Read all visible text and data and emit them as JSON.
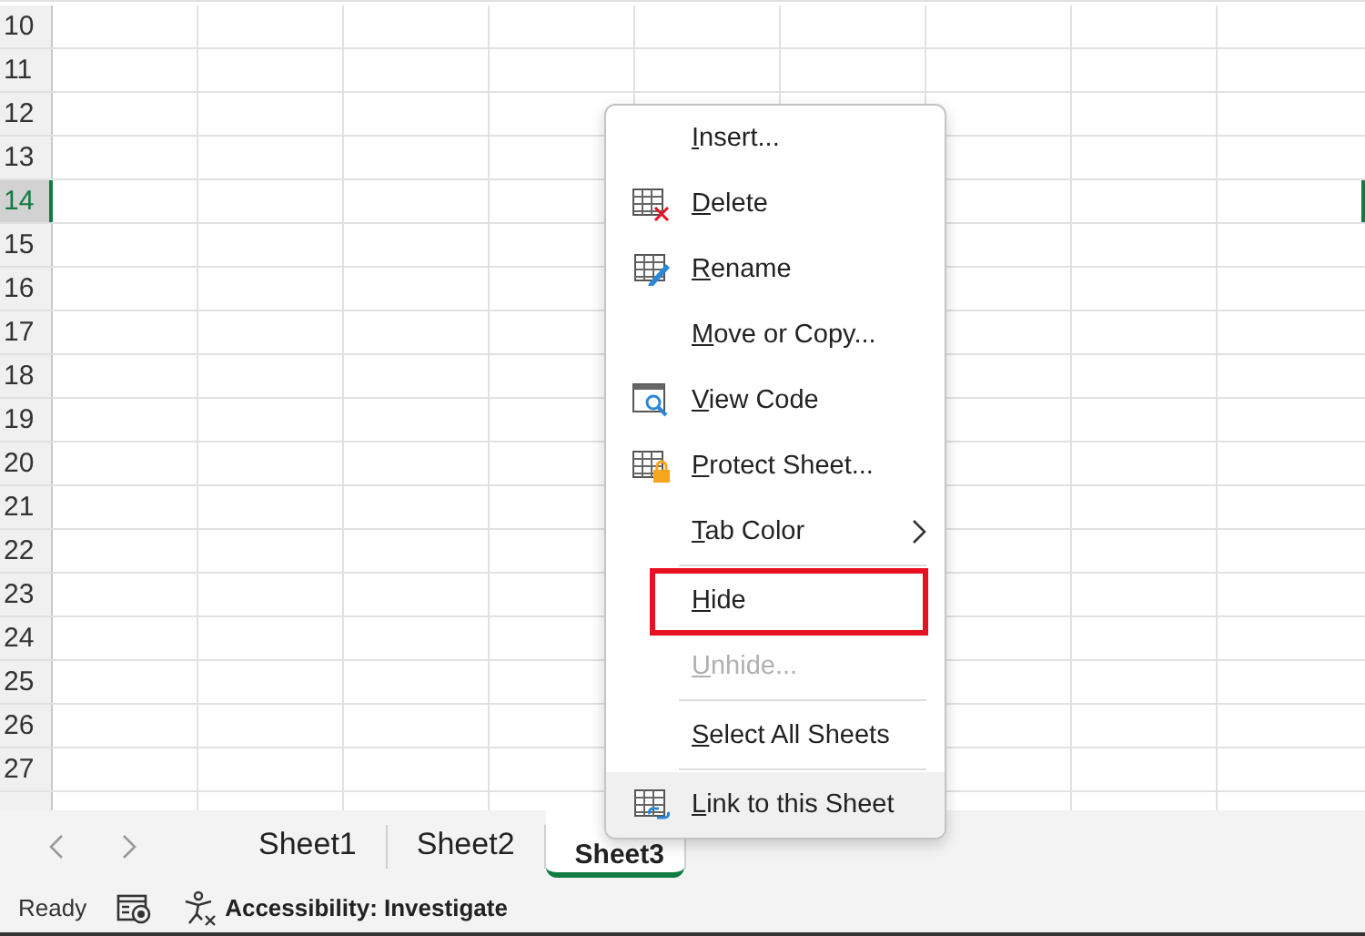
{
  "sheet": {
    "rows": [
      {
        "label": "10",
        "selected": false
      },
      {
        "label": "11",
        "selected": false
      },
      {
        "label": "12",
        "selected": false
      },
      {
        "label": "13",
        "selected": false
      },
      {
        "label": "14",
        "selected": true
      },
      {
        "label": "15",
        "selected": false
      },
      {
        "label": "16",
        "selected": false
      },
      {
        "label": "17",
        "selected": false
      },
      {
        "label": "18",
        "selected": false
      },
      {
        "label": "19",
        "selected": false
      },
      {
        "label": "20",
        "selected": false
      },
      {
        "label": "21",
        "selected": false
      },
      {
        "label": "22",
        "selected": false
      },
      {
        "label": "23",
        "selected": false
      },
      {
        "label": "24",
        "selected": false
      },
      {
        "label": "25",
        "selected": false
      },
      {
        "label": "26",
        "selected": false
      },
      {
        "label": "27",
        "selected": false
      }
    ]
  },
  "sheet_tabs": [
    {
      "label": "Sheet1",
      "selected": false
    },
    {
      "label": "Sheet2",
      "selected": false
    },
    {
      "label": "Sheet3",
      "selected": true
    }
  ],
  "context_menu": {
    "items": [
      {
        "label": "Insert...",
        "kind": "plain",
        "disabled": false,
        "hovered": false,
        "highlighted": false
      },
      {
        "label": "Delete",
        "kind": "delete",
        "disabled": false,
        "hovered": false,
        "highlighted": false
      },
      {
        "label": "Rename",
        "kind": "rename",
        "disabled": false,
        "hovered": false,
        "highlighted": false
      },
      {
        "label": "Move or Copy...",
        "kind": "plain",
        "disabled": false,
        "hovered": false,
        "highlighted": false
      },
      {
        "label": "View Code",
        "kind": "view-code",
        "disabled": false,
        "hovered": false,
        "highlighted": false
      },
      {
        "label": "Protect Sheet...",
        "kind": "protect",
        "disabled": false,
        "hovered": false,
        "highlighted": false
      },
      {
        "label": "Tab Color",
        "kind": "submenu",
        "disabled": false,
        "hovered": false,
        "highlighted": false
      },
      {
        "label": "Hide",
        "kind": "plain",
        "disabled": false,
        "hovered": false,
        "highlighted": true
      },
      {
        "label": "Unhide...",
        "kind": "plain",
        "disabled": true,
        "hovered": false,
        "highlighted": false
      },
      {
        "label": "Select All Sheets",
        "kind": "plain",
        "disabled": false,
        "hovered": false,
        "highlighted": false
      },
      {
        "label": "Link to this Sheet",
        "kind": "link",
        "disabled": false,
        "hovered": true,
        "highlighted": false
      }
    ]
  },
  "status_bar": {
    "status": "Ready",
    "accessibility": "Accessibility: Investigate"
  }
}
